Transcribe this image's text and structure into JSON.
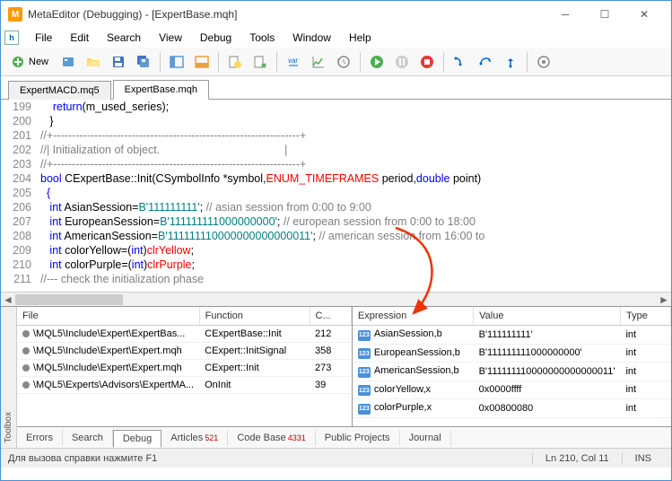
{
  "title": "MetaEditor (Debugging) - [ExpertBase.mqh]",
  "menu": {
    "file": "File",
    "edit": "Edit",
    "search": "Search",
    "view": "View",
    "debug": "Debug",
    "tools": "Tools",
    "window": "Window",
    "help": "Help"
  },
  "newLabel": "New",
  "tabs": {
    "t1": "ExpertMACD.mq5",
    "t2": "ExpertBase.mqh"
  },
  "code": {
    "l199": {
      "n": "199",
      "t": "    return(m_used_series);"
    },
    "l200": {
      "n": "200",
      "t": "   }"
    },
    "l201": {
      "n": "201",
      "t": "//+------------------------------------------------------------------+"
    },
    "l202": {
      "n": "202",
      "t": "//| Initialization of object.                                        |"
    },
    "l203": {
      "n": "203",
      "t": "//+------------------------------------------------------------------+"
    },
    "l204": {
      "n": "204"
    },
    "l205": {
      "n": "205",
      "t": "  {"
    },
    "l206": {
      "n": "206"
    },
    "l207": {
      "n": "207"
    },
    "l208": {
      "n": "208"
    },
    "l209": {
      "n": "209"
    },
    "l210": {
      "n": "210"
    },
    "l211": {
      "n": "211",
      "t": "//--- check the initialization phase"
    }
  },
  "stackHdr": {
    "file": "File",
    "func": "Function",
    "caller": "C..."
  },
  "stack": [
    {
      "file": "\\MQL5\\Include\\Expert\\ExpertBas...",
      "func": "CExpertBase::Init",
      "line": "212"
    },
    {
      "file": "\\MQL5\\Include\\Expert\\Expert.mqh",
      "func": "CExpert::InitSignal",
      "line": "358"
    },
    {
      "file": "\\MQL5\\Include\\Expert\\Expert.mqh",
      "func": "CExpert::Init",
      "line": "273"
    },
    {
      "file": "\\MQL5\\Experts\\Advisors\\ExpertMA...",
      "func": "OnInit",
      "line": "39"
    }
  ],
  "watchHdr": {
    "expr": "Expression",
    "val": "Value",
    "type": "Type"
  },
  "watch": [
    {
      "expr": "AsianSession,b",
      "val": "B'111111111'",
      "type": "int"
    },
    {
      "expr": "EuropeanSession,b",
      "val": "B'111111111000000000'",
      "type": "int"
    },
    {
      "expr": "AmericanSession,b",
      "val": "B'111111110000000000000011'",
      "type": "int"
    },
    {
      "expr": "colorYellow,x",
      "val": "0x0000ffff",
      "type": "int"
    },
    {
      "expr": "colorPurple,x",
      "val": "0x00800080",
      "type": "int"
    }
  ],
  "btabs": {
    "errors": "Errors",
    "search": "Search",
    "debug": "Debug",
    "articles": "Articles",
    "articlesN": "521",
    "codebase": "Code Base",
    "codebaseN": "4331",
    "pub": "Public Projects",
    "journal": "Journal"
  },
  "status": {
    "help": "Для вызова справки нажмите F1",
    "pos": "Ln 210, Col 11",
    "ins": "INS"
  }
}
